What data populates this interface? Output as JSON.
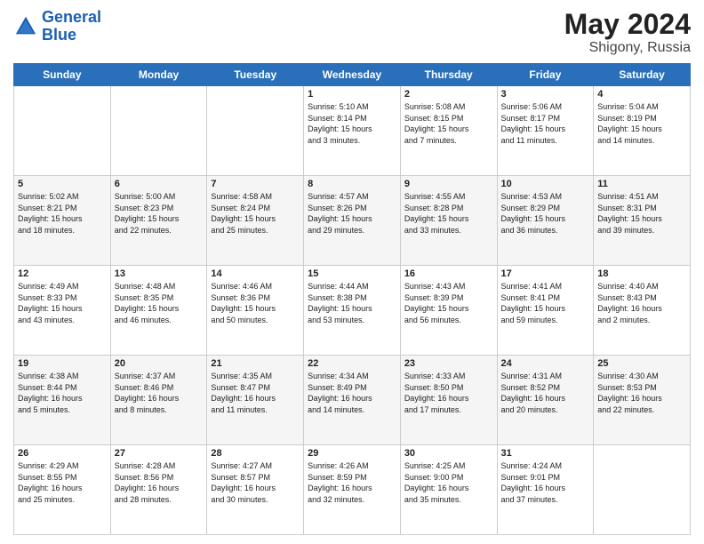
{
  "header": {
    "logo_line1": "General",
    "logo_line2": "Blue",
    "month_year": "May 2024",
    "location": "Shigony, Russia"
  },
  "days_of_week": [
    "Sunday",
    "Monday",
    "Tuesday",
    "Wednesday",
    "Thursday",
    "Friday",
    "Saturday"
  ],
  "weeks": [
    [
      {
        "day": "",
        "info": ""
      },
      {
        "day": "",
        "info": ""
      },
      {
        "day": "",
        "info": ""
      },
      {
        "day": "1",
        "info": "Sunrise: 5:10 AM\nSunset: 8:14 PM\nDaylight: 15 hours\nand 3 minutes."
      },
      {
        "day": "2",
        "info": "Sunrise: 5:08 AM\nSunset: 8:15 PM\nDaylight: 15 hours\nand 7 minutes."
      },
      {
        "day": "3",
        "info": "Sunrise: 5:06 AM\nSunset: 8:17 PM\nDaylight: 15 hours\nand 11 minutes."
      },
      {
        "day": "4",
        "info": "Sunrise: 5:04 AM\nSunset: 8:19 PM\nDaylight: 15 hours\nand 14 minutes."
      }
    ],
    [
      {
        "day": "5",
        "info": "Sunrise: 5:02 AM\nSunset: 8:21 PM\nDaylight: 15 hours\nand 18 minutes."
      },
      {
        "day": "6",
        "info": "Sunrise: 5:00 AM\nSunset: 8:23 PM\nDaylight: 15 hours\nand 22 minutes."
      },
      {
        "day": "7",
        "info": "Sunrise: 4:58 AM\nSunset: 8:24 PM\nDaylight: 15 hours\nand 25 minutes."
      },
      {
        "day": "8",
        "info": "Sunrise: 4:57 AM\nSunset: 8:26 PM\nDaylight: 15 hours\nand 29 minutes."
      },
      {
        "day": "9",
        "info": "Sunrise: 4:55 AM\nSunset: 8:28 PM\nDaylight: 15 hours\nand 33 minutes."
      },
      {
        "day": "10",
        "info": "Sunrise: 4:53 AM\nSunset: 8:29 PM\nDaylight: 15 hours\nand 36 minutes."
      },
      {
        "day": "11",
        "info": "Sunrise: 4:51 AM\nSunset: 8:31 PM\nDaylight: 15 hours\nand 39 minutes."
      }
    ],
    [
      {
        "day": "12",
        "info": "Sunrise: 4:49 AM\nSunset: 8:33 PM\nDaylight: 15 hours\nand 43 minutes."
      },
      {
        "day": "13",
        "info": "Sunrise: 4:48 AM\nSunset: 8:35 PM\nDaylight: 15 hours\nand 46 minutes."
      },
      {
        "day": "14",
        "info": "Sunrise: 4:46 AM\nSunset: 8:36 PM\nDaylight: 15 hours\nand 50 minutes."
      },
      {
        "day": "15",
        "info": "Sunrise: 4:44 AM\nSunset: 8:38 PM\nDaylight: 15 hours\nand 53 minutes."
      },
      {
        "day": "16",
        "info": "Sunrise: 4:43 AM\nSunset: 8:39 PM\nDaylight: 15 hours\nand 56 minutes."
      },
      {
        "day": "17",
        "info": "Sunrise: 4:41 AM\nSunset: 8:41 PM\nDaylight: 15 hours\nand 59 minutes."
      },
      {
        "day": "18",
        "info": "Sunrise: 4:40 AM\nSunset: 8:43 PM\nDaylight: 16 hours\nand 2 minutes."
      }
    ],
    [
      {
        "day": "19",
        "info": "Sunrise: 4:38 AM\nSunset: 8:44 PM\nDaylight: 16 hours\nand 5 minutes."
      },
      {
        "day": "20",
        "info": "Sunrise: 4:37 AM\nSunset: 8:46 PM\nDaylight: 16 hours\nand 8 minutes."
      },
      {
        "day": "21",
        "info": "Sunrise: 4:35 AM\nSunset: 8:47 PM\nDaylight: 16 hours\nand 11 minutes."
      },
      {
        "day": "22",
        "info": "Sunrise: 4:34 AM\nSunset: 8:49 PM\nDaylight: 16 hours\nand 14 minutes."
      },
      {
        "day": "23",
        "info": "Sunrise: 4:33 AM\nSunset: 8:50 PM\nDaylight: 16 hours\nand 17 minutes."
      },
      {
        "day": "24",
        "info": "Sunrise: 4:31 AM\nSunset: 8:52 PM\nDaylight: 16 hours\nand 20 minutes."
      },
      {
        "day": "25",
        "info": "Sunrise: 4:30 AM\nSunset: 8:53 PM\nDaylight: 16 hours\nand 22 minutes."
      }
    ],
    [
      {
        "day": "26",
        "info": "Sunrise: 4:29 AM\nSunset: 8:55 PM\nDaylight: 16 hours\nand 25 minutes."
      },
      {
        "day": "27",
        "info": "Sunrise: 4:28 AM\nSunset: 8:56 PM\nDaylight: 16 hours\nand 28 minutes."
      },
      {
        "day": "28",
        "info": "Sunrise: 4:27 AM\nSunset: 8:57 PM\nDaylight: 16 hours\nand 30 minutes."
      },
      {
        "day": "29",
        "info": "Sunrise: 4:26 AM\nSunset: 8:59 PM\nDaylight: 16 hours\nand 32 minutes."
      },
      {
        "day": "30",
        "info": "Sunrise: 4:25 AM\nSunset: 9:00 PM\nDaylight: 16 hours\nand 35 minutes."
      },
      {
        "day": "31",
        "info": "Sunrise: 4:24 AM\nSunset: 9:01 PM\nDaylight: 16 hours\nand 37 minutes."
      },
      {
        "day": "",
        "info": ""
      }
    ]
  ]
}
